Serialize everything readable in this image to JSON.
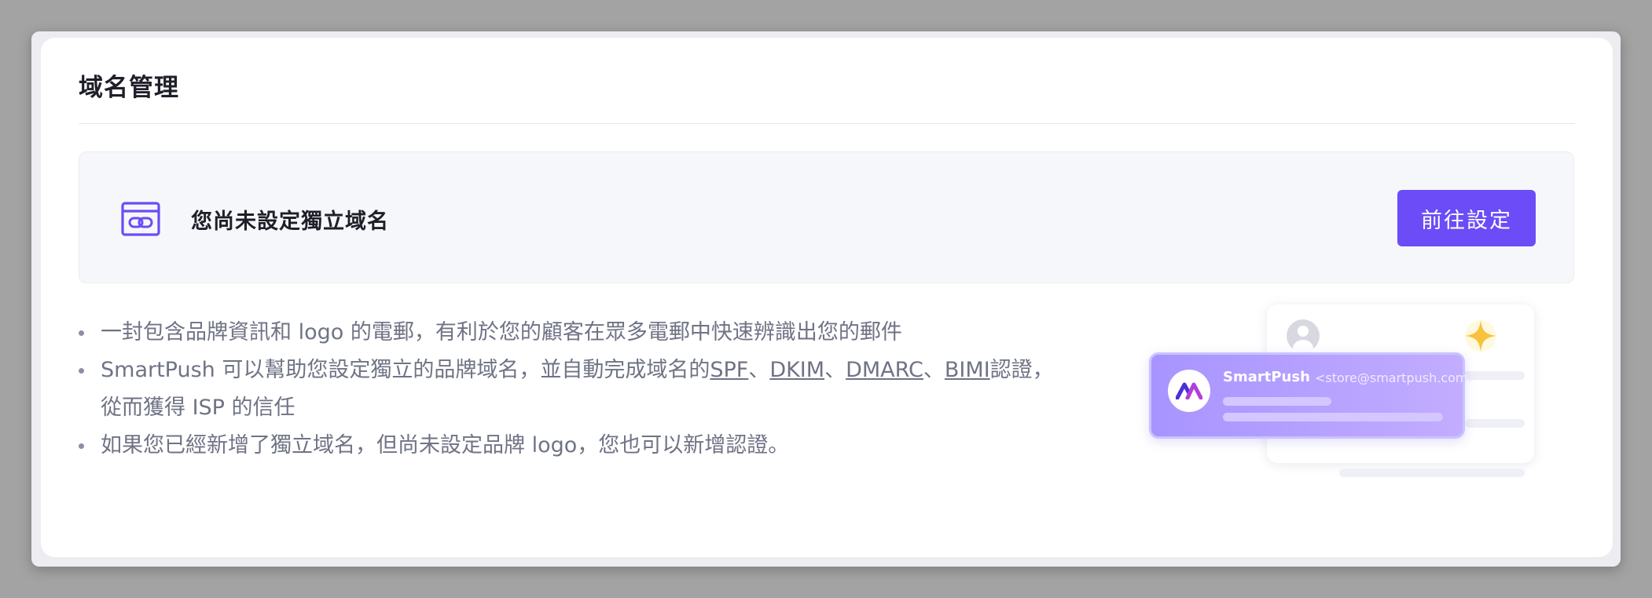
{
  "page": {
    "title": "域名管理"
  },
  "notice": {
    "message": "您尚未設定獨立域名",
    "button_label": "前往設定",
    "icon": "browser-link-icon"
  },
  "info": {
    "point1": "一封包含品牌資訊和 logo 的電郵，有利於您的顧客在眾多電郵中快速辨識出您的郵件",
    "point2_prefix": "SmartPush 可以幫助您設定獨立的品牌域名，並自動完成域名的",
    "link_spf": "SPF",
    "sep1": "、",
    "link_dkim": "DKIM",
    "sep2": "、",
    "link_dmarc": "DMARC",
    "sep3": "、",
    "link_bimi": "BIMI",
    "point2_suffix": "認證，",
    "point2_line2": "從而獲得 ISP 的信任",
    "point3": "如果您已經新增了獨立域名，但尚未設定品牌 logo，您也可以新增認證。"
  },
  "illustration": {
    "sender_name": "SmartPush",
    "sender_email": "<store@smartpush.com>",
    "icons": [
      "avatar-icon",
      "sparkle-icon",
      "brand-logo-icon"
    ]
  },
  "colors": {
    "accent": "#6b4cf6",
    "text_primary": "#1f1f2a",
    "text_secondary": "#6f7385",
    "card_bg": "#f6f7fa"
  }
}
